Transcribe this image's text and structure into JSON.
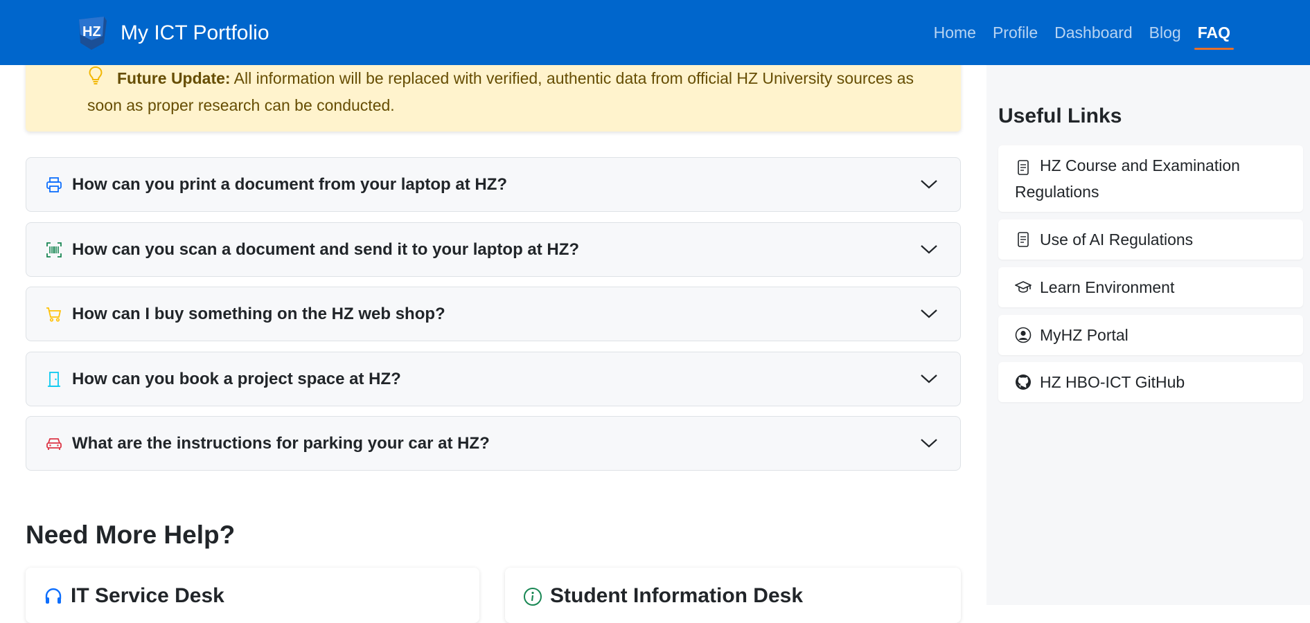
{
  "navbar": {
    "brand_title": "My ICT Portfolio",
    "logo_text": "HZ",
    "links": [
      "Home",
      "Profile",
      "Dashboard",
      "Blog",
      "FAQ"
    ],
    "active_link": "FAQ"
  },
  "alert": {
    "label": "Future Update:",
    "text": " All information will be replaced with verified, authentic data from official HZ University sources as soon as proper research can be conducted.",
    "icon": "lightbulb-icon"
  },
  "faq": [
    {
      "question": "How can you print a document from your laptop at HZ?",
      "icon": "printer-icon",
      "icon_color": "#0d6efd"
    },
    {
      "question": "How can you scan a document and send it to your laptop at HZ?",
      "icon": "barcode-scan-icon",
      "icon_color": "#198754"
    },
    {
      "question": "How can I buy something on the HZ web shop?",
      "icon": "cart-icon",
      "icon_color": "#ffc107"
    },
    {
      "question": "How can you book a project space at HZ?",
      "icon": "door-icon",
      "icon_color": "#0dcaf0"
    },
    {
      "question": "What are the instructions for parking your car at HZ?",
      "icon": "car-icon",
      "icon_color": "#dc3545"
    }
  ],
  "help": {
    "title": "Need More Help?",
    "cards": [
      {
        "title": "IT Service Desk",
        "icon": "headset-icon",
        "icon_color": "#0d6efd"
      },
      {
        "title": "Student Information Desk",
        "icon": "info-circle-icon",
        "icon_color": "#198754"
      }
    ]
  },
  "sidebar": {
    "title": "Useful Links",
    "links": [
      {
        "label": "HZ Course and Examination Regulations",
        "icon": "document-icon"
      },
      {
        "label": "Use of AI Regulations",
        "icon": "document-icon"
      },
      {
        "label": "Learn Environment",
        "icon": "mortarboard-icon"
      },
      {
        "label": "MyHZ Portal",
        "icon": "person-circle-icon"
      },
      {
        "label": "HZ HBO-ICT GitHub",
        "icon": "github-icon"
      }
    ]
  },
  "colors": {
    "navbar_bg": "#0066cc",
    "active_underline": "#e8702a",
    "alert_bg": "#fff3cd",
    "alert_text": "#664d03"
  }
}
